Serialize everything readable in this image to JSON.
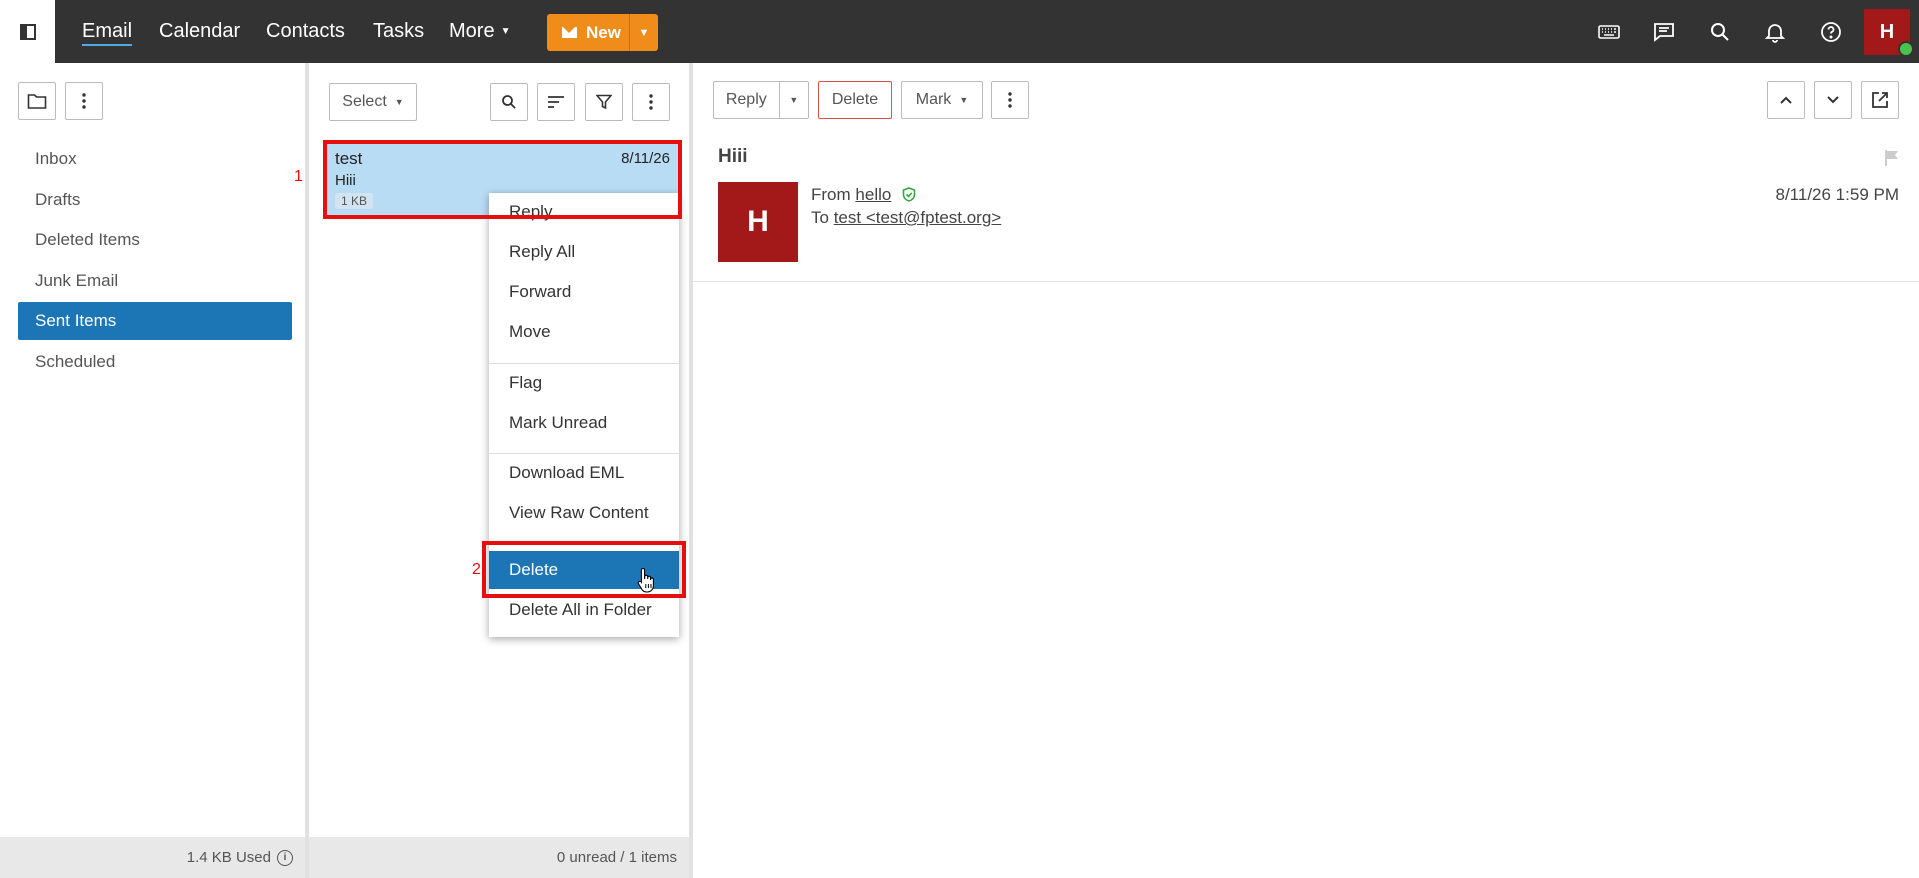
{
  "topnav": {
    "links": [
      "Email",
      "Calendar",
      "Contacts",
      "Tasks",
      "More"
    ],
    "new_label": "New",
    "user_initial": "H",
    "icons": [
      "keyboard-icon",
      "chat-icon",
      "search-icon",
      "bell-icon",
      "help-icon"
    ]
  },
  "folders": {
    "items": [
      "Inbox",
      "Drafts",
      "Deleted Items",
      "Junk Email",
      "Sent Items",
      "Scheduled"
    ],
    "selected": "Sent Items",
    "storage_used": "1.4 KB Used"
  },
  "message_list": {
    "select_label": "Select",
    "messages": [
      {
        "from": "test",
        "date": "8/11/26",
        "subject": "Hiii",
        "size": "1 KB"
      }
    ],
    "footer": "0 unread / 1 items"
  },
  "context_menu": {
    "items": [
      "Reply",
      "Reply All",
      "Forward",
      "Move",
      "Flag",
      "Mark Unread",
      "Download EML",
      "View Raw Content",
      "Delete",
      "Delete All in Folder"
    ],
    "highlighted": "Delete"
  },
  "annotations": [
    "1",
    "2"
  ],
  "reading_pane": {
    "toolbar": {
      "reply": "Reply",
      "delete": "Delete",
      "mark": "Mark"
    },
    "subject": "Hiii",
    "sender_initial": "H",
    "from_label": "From",
    "from_name": "hello",
    "to_label": "To",
    "to_value": "test <test@fptest.org>",
    "datetime": "8/11/26 1:59 PM"
  },
  "colors": {
    "topbar": "#333333",
    "accent_blue": "#1c76b6",
    "new_button": "#ef8c1a",
    "avatar": "#a31818",
    "selected_message": "#b9dcf5",
    "annotation": "#e60f0f"
  }
}
